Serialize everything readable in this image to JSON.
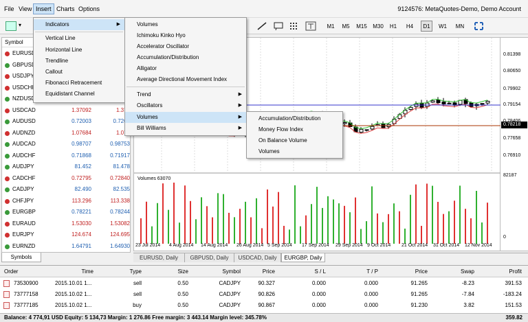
{
  "menubar": {
    "items": [
      "File",
      "View",
      "Insert",
      "Charts",
      "Options"
    ],
    "active": "Insert",
    "account": "9124576: MetaQuotes-Demo, Demo Account"
  },
  "timeframes": [
    "M1",
    "M5",
    "M15",
    "M30",
    "H1",
    "H4",
    "D1",
    "W1",
    "MN"
  ],
  "selected_timeframe": "D1",
  "market_watch": {
    "header": "Symbol",
    "tab": "Symbols",
    "rows": [
      {
        "symbol": "EURUSD",
        "bid": "",
        "ask": "",
        "dir": "down"
      },
      {
        "symbol": "GBPUSD",
        "bid": "",
        "ask": "",
        "dir": "up"
      },
      {
        "symbol": "USDJPY",
        "bid": "",
        "ask": "",
        "dir": "down"
      },
      {
        "symbol": "USDCHF",
        "bid": "",
        "ask": "",
        "dir": "down"
      },
      {
        "symbol": "NZDUSD",
        "bid": "",
        "ask": "",
        "dir": "up"
      },
      {
        "symbol": "USDCAD",
        "bid": "1.37092",
        "ask": "1.371",
        "dir": "down"
      },
      {
        "symbol": "AUDUSD",
        "bid": "0.72003",
        "ask": "0.7202",
        "dir": "up"
      },
      {
        "symbol": "AUDNZD",
        "bid": "1.07684",
        "ask": "1.077",
        "dir": "down"
      },
      {
        "symbol": "AUDCAD",
        "bid": "0.98707",
        "ask": "0.98753",
        "dir": "up"
      },
      {
        "symbol": "AUDCHF",
        "bid": "0.71868",
        "ask": "0.71917",
        "dir": "up"
      },
      {
        "symbol": "AUDJPY",
        "bid": "81.452",
        "ask": "81.478",
        "dir": "up"
      },
      {
        "symbol": "CADCHF",
        "bid": "0.72795",
        "ask": "0.72840",
        "dir": "down"
      },
      {
        "symbol": "CADJPY",
        "bid": "82.490",
        "ask": "82.535",
        "dir": "up"
      },
      {
        "symbol": "CHFJPY",
        "bid": "113.296",
        "ask": "113.338",
        "dir": "down"
      },
      {
        "symbol": "EURGBP",
        "bid": "0.78221",
        "ask": "0.78244",
        "dir": "up"
      },
      {
        "symbol": "EURAUD",
        "bid": "1.53030",
        "ask": "1.53082",
        "dir": "down"
      },
      {
        "symbol": "EURJPY",
        "bid": "124.674",
        "ask": "124.695",
        "dir": "down"
      },
      {
        "symbol": "EURNZD",
        "bid": "1.64791",
        "ask": "1.64930",
        "dir": "up"
      }
    ]
  },
  "insert_menu": {
    "items": [
      "Indicators",
      "Vertical Line",
      "Horizontal Line",
      "Trendline",
      "Callout",
      "Fibonacci Retracement",
      "Equidistant Channel"
    ]
  },
  "indicators_menu": {
    "items": [
      "Volumes",
      "Ichimoku Kinko Hyo",
      "Accelerator Oscillator",
      "Accumulation/Distribution",
      "Alligator",
      "Average Directional Movement Index",
      "Trend",
      "Oscillators",
      "Volumes",
      "Bill Williams"
    ]
  },
  "volumes_menu": {
    "items": [
      "Accumulation/Distribution",
      "Money Flow Index",
      "On Balance Volume",
      "Volumes"
    ]
  },
  "chart": {
    "volume_label": "Volumes 63070",
    "price_labels": [
      "0.81398",
      "0.80650",
      "0.79902",
      "0.79154",
      "0.78406",
      "0.77658",
      "0.76910"
    ],
    "current_price": "0.78218",
    "volume_scale": [
      "82187",
      "0"
    ],
    "dates": [
      "23 Jul 2014",
      "4 Aug 2014",
      "14 Aug 2014",
      "26 Aug 2014",
      "5 Sep 2014",
      "17 Sep 2014",
      "29 Sep 2014",
      "9 Oct 2014",
      "21 Oct 2014",
      "31 Oct 2014",
      "12 Nov 2014"
    ]
  },
  "chart_tabs": [
    "EURUSD, Daily",
    "GBPUSD, Daily",
    "USDCAD, Daily",
    "EURGBP, Daily"
  ],
  "active_chart_tab": "EURGBP, Daily",
  "orders": {
    "columns": [
      "Order",
      "Time",
      "Type",
      "Size",
      "Symbol",
      "Price",
      "S / L",
      "T / P",
      "Price",
      "Swap",
      "Profit"
    ],
    "rows": [
      [
        "73530900",
        "2015.10.01 1...",
        "sell",
        "0.50",
        "CADJPY",
        "90.327",
        "0.000",
        "0.000",
        "91.265",
        "-8.23",
        "391.53"
      ],
      [
        "73777158",
        "2015.10.02 1...",
        "sell",
        "0.50",
        "CADJPY",
        "90.826",
        "0.000",
        "0.000",
        "91.265",
        "-7.84",
        "-183.24"
      ],
      [
        "73777185",
        "2015.10.02 1...",
        "buy",
        "0.50",
        "CADJPY",
        "90.867",
        "0.000",
        "0.000",
        "91.230",
        "3.82",
        "151.53"
      ]
    ]
  },
  "status": {
    "text": "Balance: 4 774,91 USD  Equity: 5 134,73  Margin: 1 276.86  Free margin: 3 443.14  Margin level: 345.78%",
    "profit": "359.82"
  }
}
